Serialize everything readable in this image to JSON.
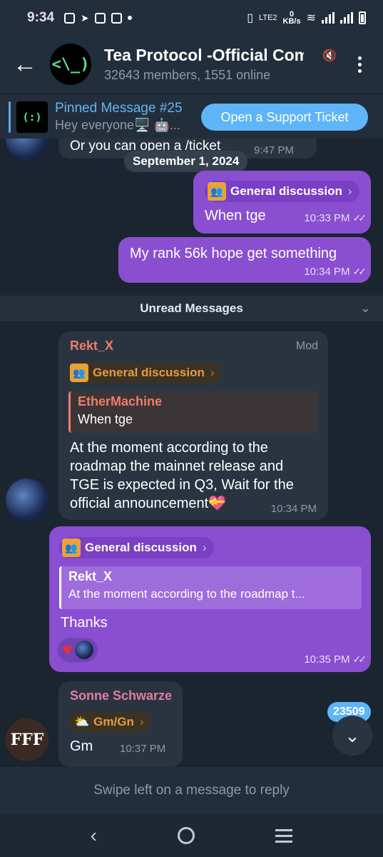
{
  "status_bar": {
    "time": "9:34",
    "network": "LTE2",
    "speed": "0",
    "speed_unit": "KB/s"
  },
  "header": {
    "title": "Tea Protocol -Official Community",
    "subtitle": "32643 members, 1551 online",
    "avatar_text": "<\\_)"
  },
  "pinned": {
    "title": "Pinned Message #25",
    "preview": "Hey everyone🖥️ 🤖...",
    "thumb_text": "(:)",
    "button": "Open a Support Ticket"
  },
  "chat": {
    "top_partial": {
      "text": "Or you can open a /ticket",
      "time": "9:47 PM"
    },
    "date_separator": "September 1, 2024",
    "out1": {
      "topic": "General discussion",
      "text": "When tge",
      "time": "10:33 PM"
    },
    "out2": {
      "text": "My rank 56k hope get something",
      "time": "10:34 PM"
    },
    "unread_label": "Unread Messages",
    "in1": {
      "sender": "Rekt_X",
      "role": "Mod",
      "topic": "General discussion",
      "reply_name": "EtherMachine",
      "reply_text": "When tge",
      "text": "At the moment according to the roadmap the mainnet release and TGE is expected in Q3, Wait for the official announcement💝",
      "time": "10:34 PM"
    },
    "out3": {
      "topic": "General discussion",
      "reply_name": "Rekt_X",
      "reply_text": "At the moment according to the roadmap t...",
      "text": "Thanks",
      "time": "10:35 PM"
    },
    "in2": {
      "sender": "Sonne Schwarze",
      "topic": "Gm/Gn",
      "text": "Gm",
      "time": "10:37 PM",
      "avatar_text": "FFF"
    }
  },
  "unread_count": "23509",
  "reply_hint": "Swipe left on a message to reply",
  "colors": {
    "accent": "#5eb5f7",
    "outgoing_bubble": "#8a4fd0",
    "incoming_bubble": "#2a3441",
    "mod_name": "#ef7c6c",
    "topic_orange": "#e89a3c"
  }
}
